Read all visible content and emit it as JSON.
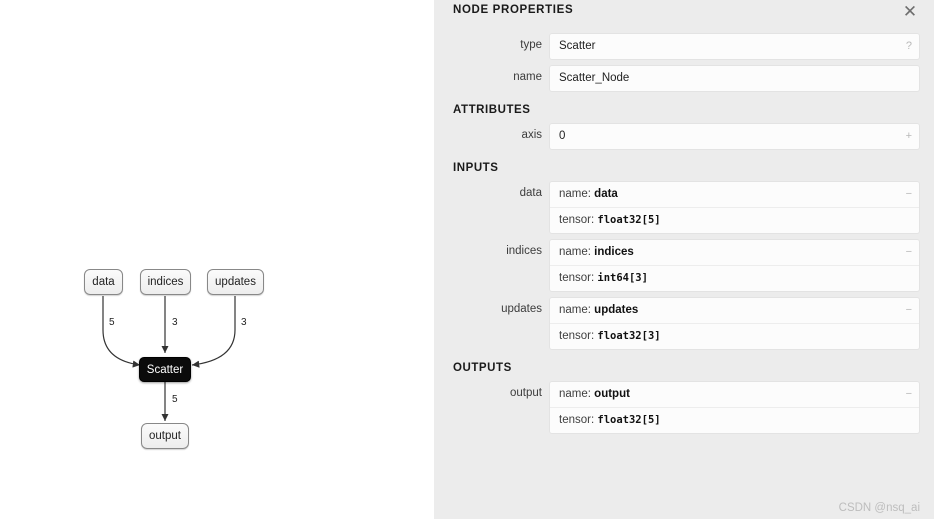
{
  "panel": {
    "title": "NODE PROPERTIES",
    "close_icon": "close-icon",
    "sections": {
      "attributes_head": "ATTRIBUTES",
      "inputs_head": "INPUTS",
      "outputs_head": "OUTPUTS"
    },
    "top_fields": [
      {
        "label": "type",
        "value": "Scatter",
        "affordance": "?"
      },
      {
        "label": "name",
        "value": "Scatter_Node",
        "affordance": ""
      }
    ],
    "attributes": [
      {
        "label": "axis",
        "value": "0",
        "affordance": "+"
      }
    ],
    "inputs": [
      {
        "label": "data",
        "name_key": "name:",
        "name_value": "data",
        "tensor_key": "tensor:",
        "tensor_value": "float32[5]",
        "affordance": "−"
      },
      {
        "label": "indices",
        "name_key": "name:",
        "name_value": "indices",
        "tensor_key": "tensor:",
        "tensor_value": "int64[3]",
        "affordance": "−"
      },
      {
        "label": "updates",
        "name_key": "name:",
        "name_value": "updates",
        "tensor_key": "tensor:",
        "tensor_value": "float32[3]",
        "affordance": "−"
      }
    ],
    "outputs": [
      {
        "label": "output",
        "name_key": "name:",
        "name_value": "output",
        "tensor_key": "tensor:",
        "tensor_value": "float32[5]",
        "affordance": "−"
      }
    ],
    "watermark": "CSDN @nsq_ai"
  },
  "graph": {
    "nodes": [
      {
        "id": "data",
        "label": "data",
        "kind": "io"
      },
      {
        "id": "indices",
        "label": "indices",
        "kind": "io"
      },
      {
        "id": "updates",
        "label": "updates",
        "kind": "io"
      },
      {
        "id": "scatter",
        "label": "Scatter",
        "kind": "op"
      },
      {
        "id": "output",
        "label": "output",
        "kind": "io"
      }
    ],
    "edge_labels": {
      "data_to_scatter": "5",
      "indices_to_scatter": "3",
      "updates_to_scatter": "3",
      "scatter_to_output": "5"
    }
  },
  "colors": {
    "panel_bg": "#ececec",
    "field_bg": "#fcfcfc",
    "op_node_bg": "#0b0b0b",
    "io_node_border": "#888888",
    "watermark": "#bdbdbd"
  }
}
